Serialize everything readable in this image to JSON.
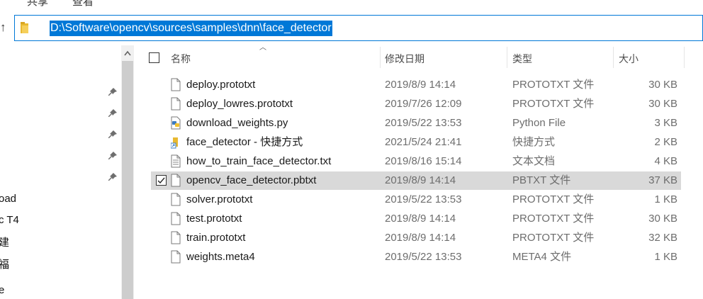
{
  "menu": [
    "共享",
    "查看"
  ],
  "address": {
    "path": "D:\\Software\\opencv\\sources\\samples\\dnn\\face_detector"
  },
  "nav_pane": {
    "items": [
      "oad",
      "c T4",
      "建",
      "福",
      "e"
    ]
  },
  "columns": {
    "name": "名称",
    "date": "修改日期",
    "type": "类型",
    "size": "大小"
  },
  "files": [
    {
      "name": "deploy.prototxt",
      "date": "2019/8/9 14:14",
      "type": "PROTOTXT 文件",
      "size": "30 KB",
      "icon": "file-icon",
      "selected": false
    },
    {
      "name": "deploy_lowres.prototxt",
      "date": "2019/7/26 12:09",
      "type": "PROTOTXT 文件",
      "size": "30 KB",
      "icon": "file-icon",
      "selected": false
    },
    {
      "name": "download_weights.py",
      "date": "2019/5/22 13:53",
      "type": "Python File",
      "size": "3 KB",
      "icon": "python-file-icon",
      "selected": false
    },
    {
      "name": "face_detector - 快捷方式",
      "date": "2021/5/24 21:41",
      "type": "快捷方式",
      "size": "2 KB",
      "icon": "shortcut-icon",
      "selected": false
    },
    {
      "name": "how_to_train_face_detector.txt",
      "date": "2019/8/16 15:14",
      "type": "文本文档",
      "size": "4 KB",
      "icon": "text-file-icon",
      "selected": false
    },
    {
      "name": "opencv_face_detector.pbtxt",
      "date": "2019/8/9 14:14",
      "type": "PBTXT 文件",
      "size": "37 KB",
      "icon": "file-icon",
      "selected": true
    },
    {
      "name": "solver.prototxt",
      "date": "2019/5/22 13:53",
      "type": "PROTOTXT 文件",
      "size": "1 KB",
      "icon": "file-icon",
      "selected": false
    },
    {
      "name": "test.prototxt",
      "date": "2019/8/9 14:14",
      "type": "PROTOTXT 文件",
      "size": "30 KB",
      "icon": "file-icon",
      "selected": false
    },
    {
      "name": "train.prototxt",
      "date": "2019/8/9 14:14",
      "type": "PROTOTXT 文件",
      "size": "32 KB",
      "icon": "file-icon",
      "selected": false
    },
    {
      "name": "weights.meta4",
      "date": "2019/5/22 13:53",
      "type": "META4 文件",
      "size": "1 KB",
      "icon": "file-icon",
      "selected": false
    }
  ],
  "colors": {
    "accent": "#0078d7",
    "selection": "#d9d9d9",
    "scroll_thumb": "#cdcdcd"
  }
}
